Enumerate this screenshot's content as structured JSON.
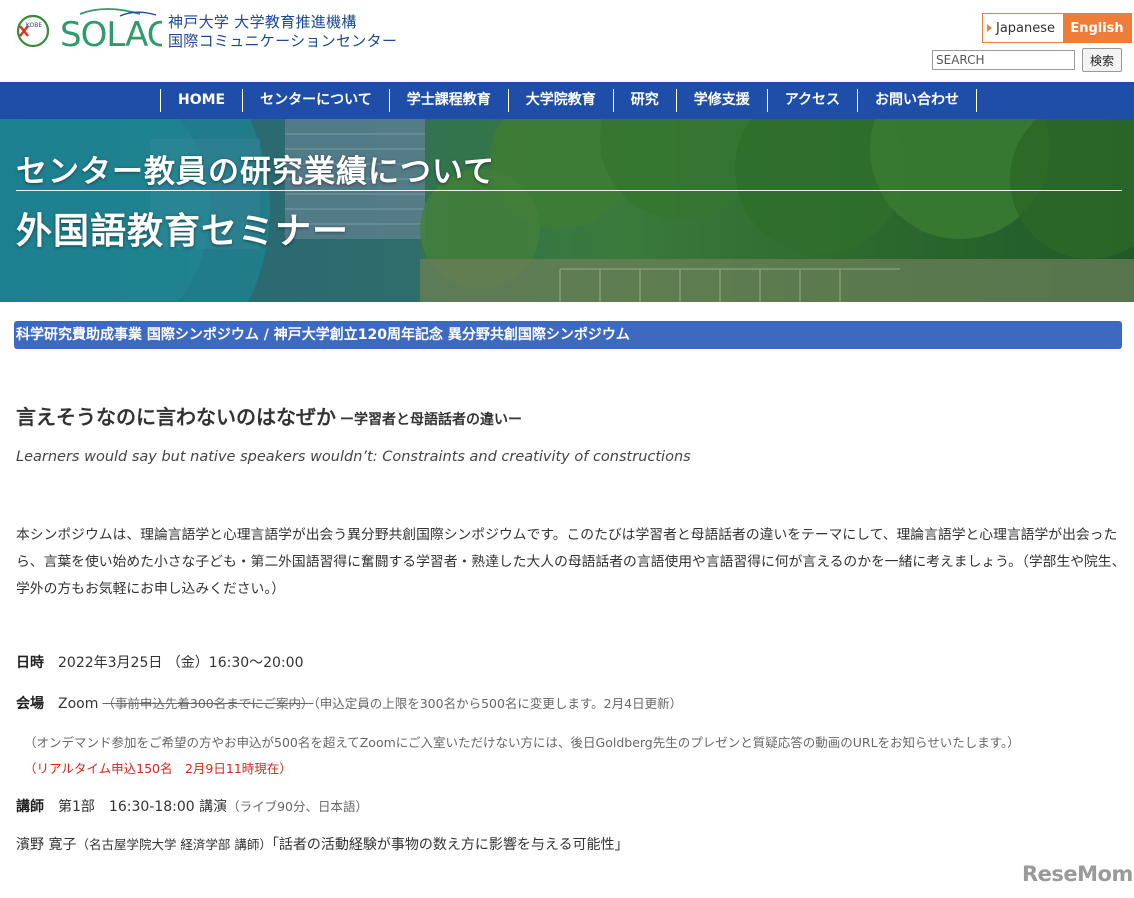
{
  "header": {
    "kobe_logo_text": "KOBE",
    "solac_logo_text": "SOLAC",
    "org_line1": "神戸大学 大学教育推進機構",
    "org_line2": "国際コミュニケーションセンター",
    "lang_japanese": "Japanese",
    "lang_english": "English",
    "search_placeholder": "SEARCH",
    "search_button": "検索"
  },
  "nav": {
    "items": [
      {
        "label": "HOME"
      },
      {
        "label": "センターについて"
      },
      {
        "label": "学士課程教育"
      },
      {
        "label": "大学院教育"
      },
      {
        "label": "研究"
      },
      {
        "label": "学修支援"
      },
      {
        "label": "アクセス"
      },
      {
        "label": "お問い合わせ"
      }
    ]
  },
  "hero": {
    "title": "センター教員の研究業績について",
    "subtitle": "外国語教育セミナー"
  },
  "content": {
    "banner": "科学研究費助成事業 国際シンポジウム / 神戸大学創立120周年記念 異分野共創国際シンポジウム",
    "title": "言えそうなのに言わないのはなぜか",
    "title_sub": "ー学習者と母語話者の違いー",
    "english_title": "Learners would say but native speakers wouldn’t: Constraints and creativity of constructions",
    "description": "本シンポジウムは、理論言語学と心理言語学が出会う異分野共創国際シンポジウムです。このたびは学習者と母語話者の違いをテーマにして、理論言語学と心理言語学が出会ったら、言葉を使い始めた小さな子ども・第二外国語習得に奮闘する学習者・熟達した大人の母語話者の言語使用や言語習得に何が言えるのかを一緒に考えましょう。（学部生や院生、学外の方もお気軽にお申し込みください。）",
    "date_label": "日時",
    "date_value": "2022年3月25日 （金）16:30〜20:00",
    "venue_label": "会場",
    "venue_value": "Zoom",
    "venue_struck": "（事前申込先着300名までにご案内）",
    "venue_note": "（申込定員の上限を300名から500名に変更します。2月4日更新）",
    "ondemand_note": "（オンデマンド参加をご希望の方やお申込が500名を超えてZoomにご入室いただけない方には、後日Goldberg先生のプレゼンと質疑応答の動画のURLをお知らせいたします。）",
    "realtime_note": "（リアルタイム申込150名　2月9日11時現在）",
    "lecturer_label": "講師",
    "lecturer_value": "第1部　16:30-18:00 講演",
    "lecturer_detail": "（ライブ90分、日本語）",
    "speaker_name": "濱野 寛子",
    "speaker_affiliation": "（名古屋学院大学 経済学部 講師）",
    "speaker_talk": "「話者の活動経験が事物の数え方に影響を与える可能性」"
  },
  "watermark": "ReseMom",
  "colors": {
    "nav_bg": "#1f4ea8",
    "banner_bg": "#3d6ac0",
    "accent_orange": "#ef7d3a",
    "brand_blue": "#1a4a93",
    "notice_red": "#d7261e"
  }
}
